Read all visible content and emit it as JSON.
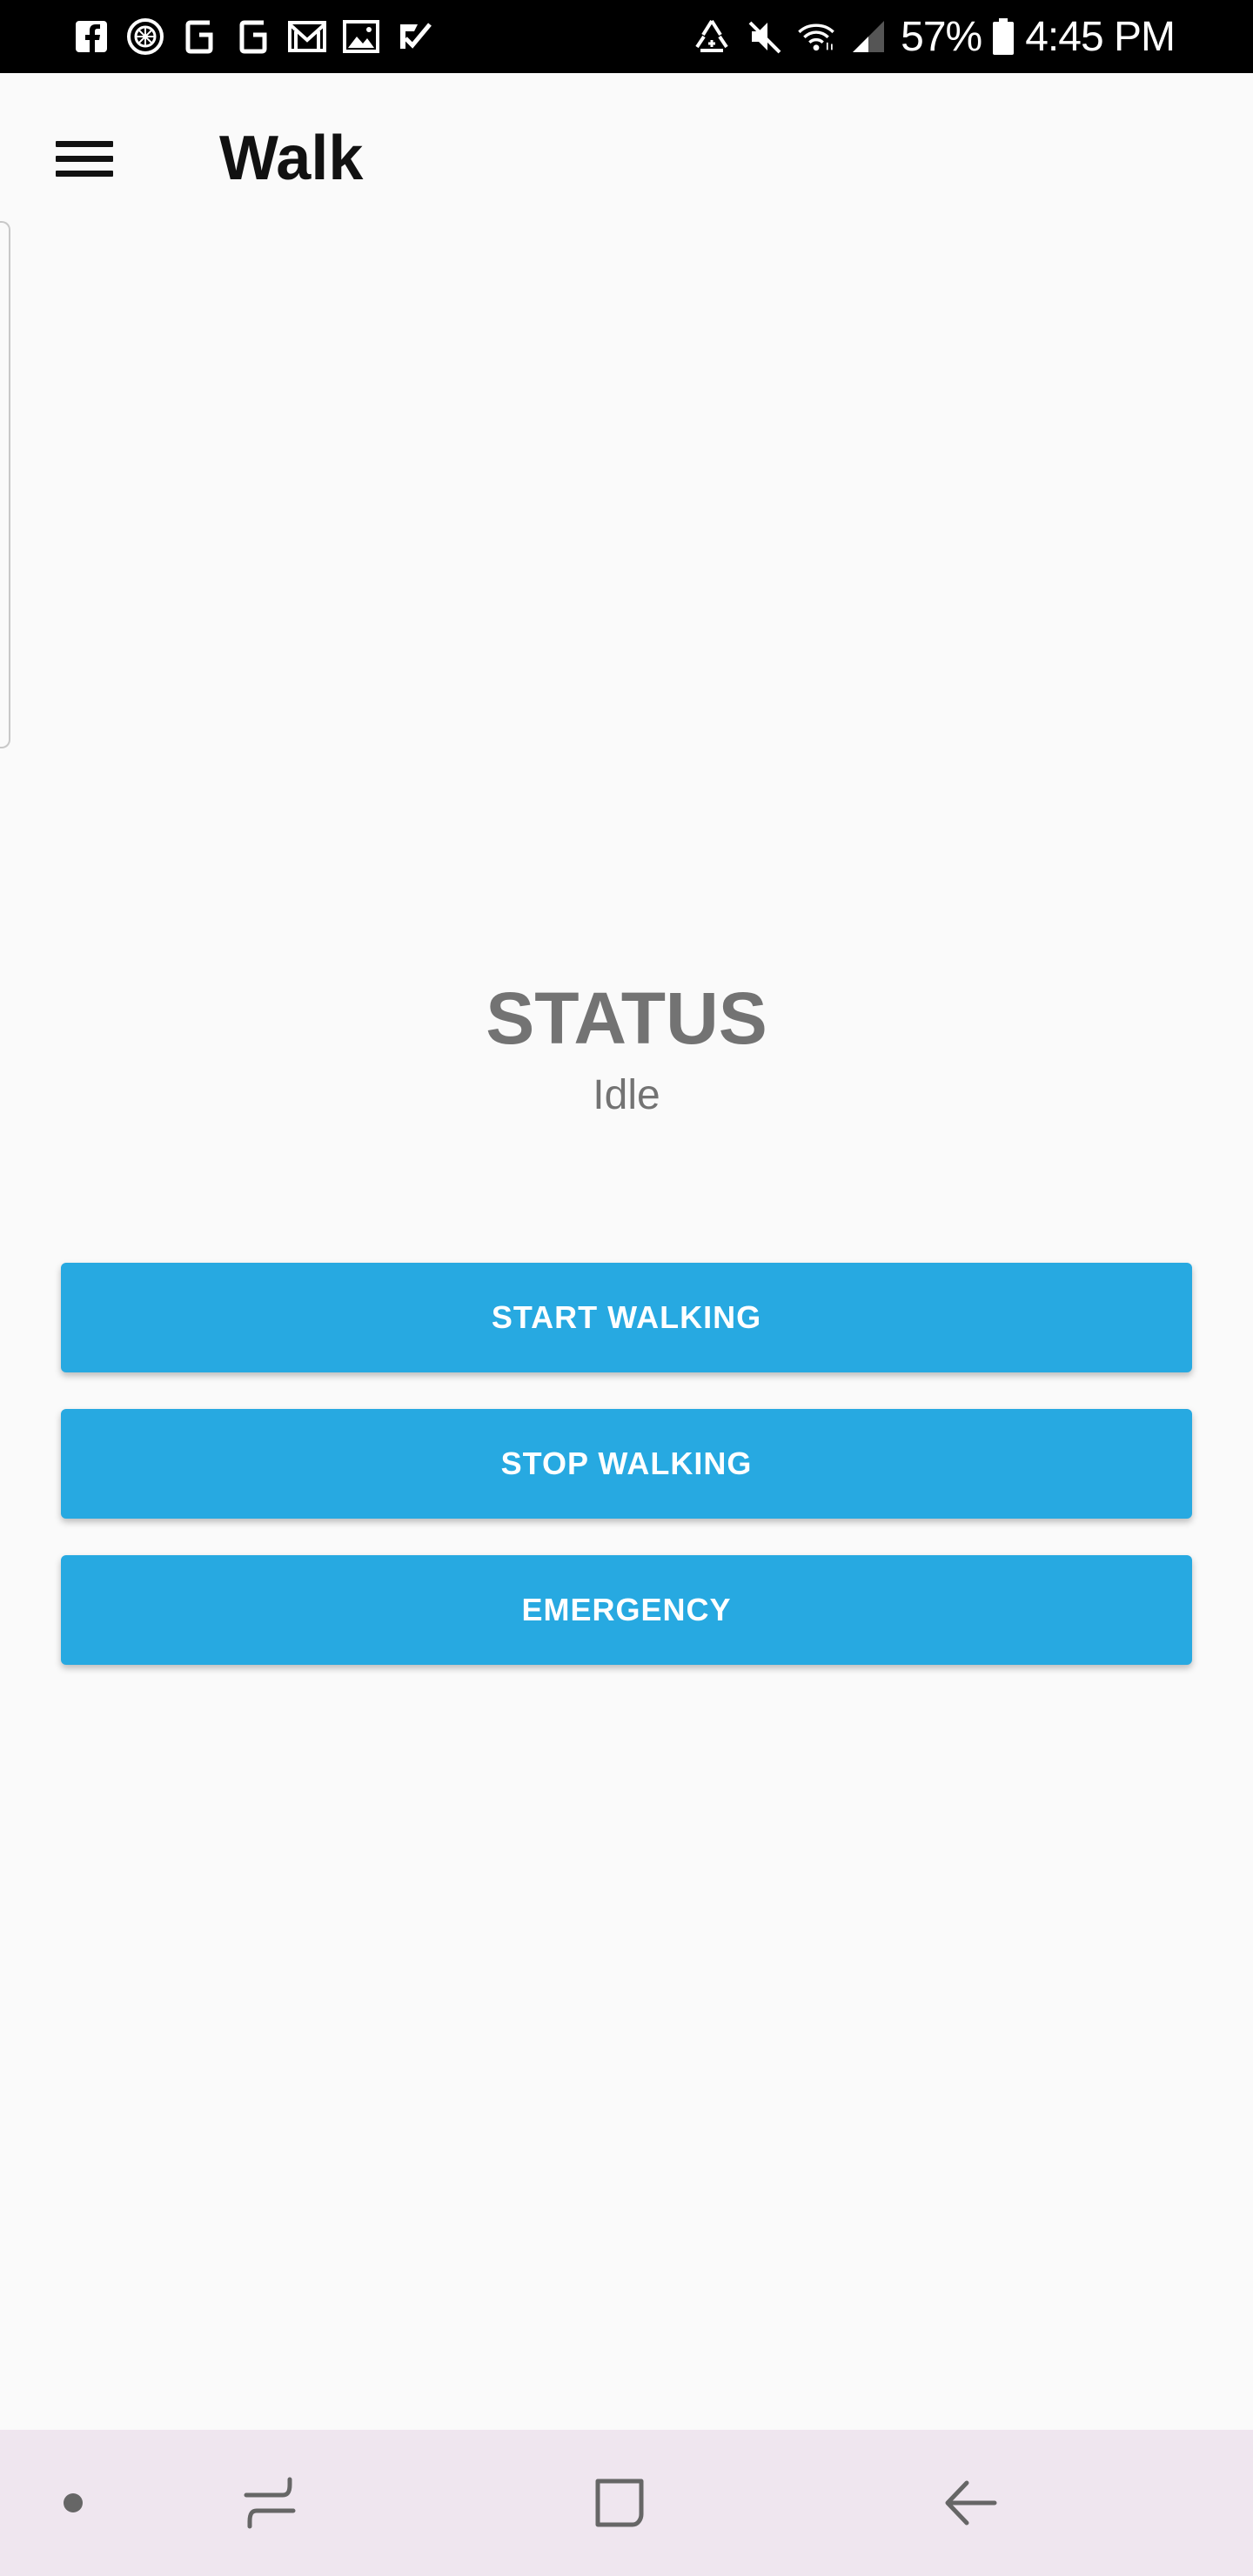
{
  "status_bar": {
    "notification_icons": [
      "facebook-icon",
      "photo-sync-icon",
      "g-app-icon",
      "g-app-icon",
      "gmail-icon",
      "gallery-icon",
      "tasks-check-icon"
    ],
    "system_icons": [
      "recycle-sync-icon",
      "mute-icon",
      "wifi-icon",
      "signal-icon"
    ],
    "battery_percent": "57%",
    "time": "4:45 PM"
  },
  "app_bar": {
    "menu_icon": "hamburger-menu-icon",
    "title": "Walk"
  },
  "status": {
    "heading": "STATUS",
    "value": "Idle"
  },
  "buttons": {
    "start_label": "START WALKING",
    "stop_label": "STOP WALKING",
    "emergency_label": "EMERGENCY"
  },
  "nav_bar": {
    "items": [
      "dot-icon",
      "recents-icon",
      "home-icon",
      "back-icon"
    ]
  },
  "colors": {
    "accent": "#27a9e1",
    "status_text": "#737373",
    "background": "#fafafa",
    "nav_background": "#efe6ef"
  }
}
